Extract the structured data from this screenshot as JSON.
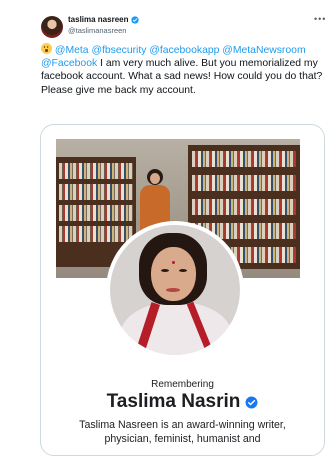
{
  "author": {
    "name": "taslima nasreen",
    "handle": "@taslimanasreen",
    "avatar_icon": "profile-photo",
    "verified": true
  },
  "more_icon": "more-horizontal-icon",
  "tweet": {
    "emoji": "astonished-face",
    "mentions": [
      "@Meta",
      "@fbsecurity",
      "@facebookapp",
      "@MetaNewsroom",
      "@Facebook"
    ],
    "body": "I am very much alive. But you memorialized my facebook account. What a sad news! How could you do that? Please give me back my account."
  },
  "card": {
    "remembering_label": "Remembering",
    "profile_name": "Taslima Nasrin",
    "verified": true,
    "bio": "Taslima Nasreen is an award-winning writer, physician, feminist, humanist and"
  },
  "colors": {
    "link": "#1d9bf0",
    "verified_badge": "#1d9bf0",
    "fb_verified_badge": "#1877f2",
    "text": "#0f1419"
  }
}
